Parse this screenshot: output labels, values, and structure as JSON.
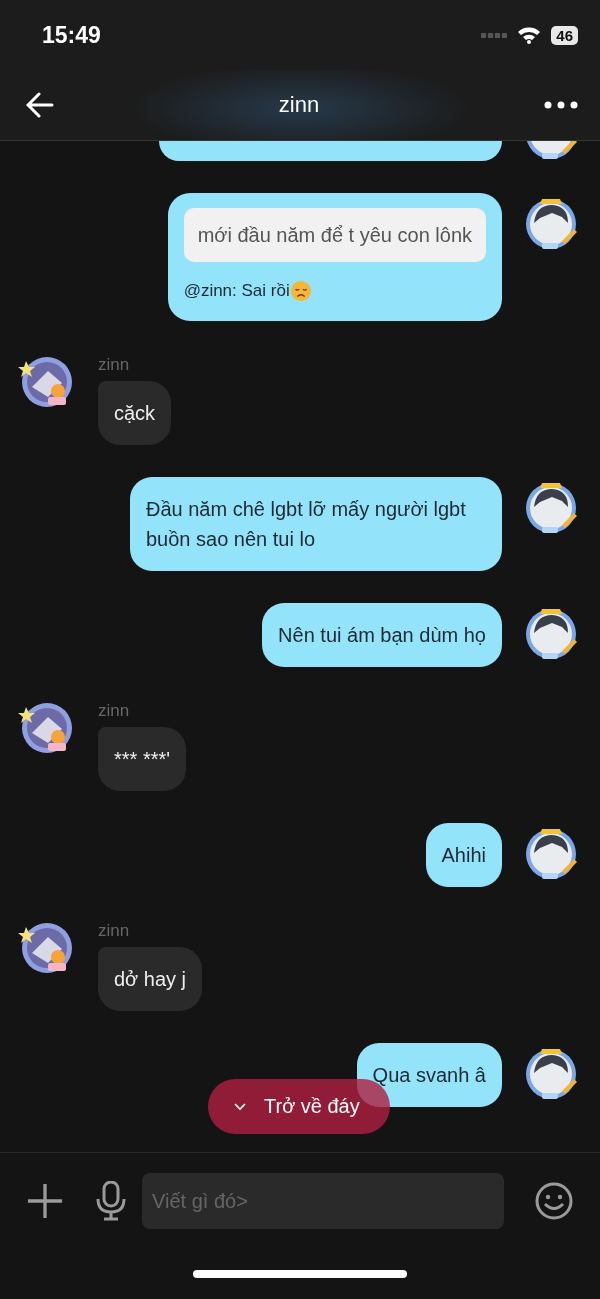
{
  "status_bar": {
    "time": "15:49",
    "battery": "46"
  },
  "header": {
    "title": "zinn"
  },
  "messages": [
    {
      "kind": "cut_off"
    },
    {
      "kind": "reply",
      "quote": "mới đầu năm để t yêu con lônk",
      "text": "@zinn: Sai rồi"
    },
    {
      "kind": "incoming",
      "sender": "zinn",
      "text": "cặck"
    },
    {
      "kind": "outgoing",
      "text": "Đầu năm chê lgbt lỡ mấy người lgbt buồn sao nên tui lo"
    },
    {
      "kind": "outgoing",
      "text": "Nên tui ám bạn dùm họ"
    },
    {
      "kind": "incoming",
      "sender": "zinn",
      "text": "*** ***'"
    },
    {
      "kind": "outgoing",
      "text": "Ahihi"
    },
    {
      "kind": "incoming",
      "sender": "zinn",
      "text": "dở hay j"
    },
    {
      "kind": "outgoing",
      "text": "Qua svanh â"
    }
  ],
  "scroll_button": {
    "label": "Trở về đáy"
  },
  "composer": {
    "placeholder": "Viết gì đó>"
  }
}
